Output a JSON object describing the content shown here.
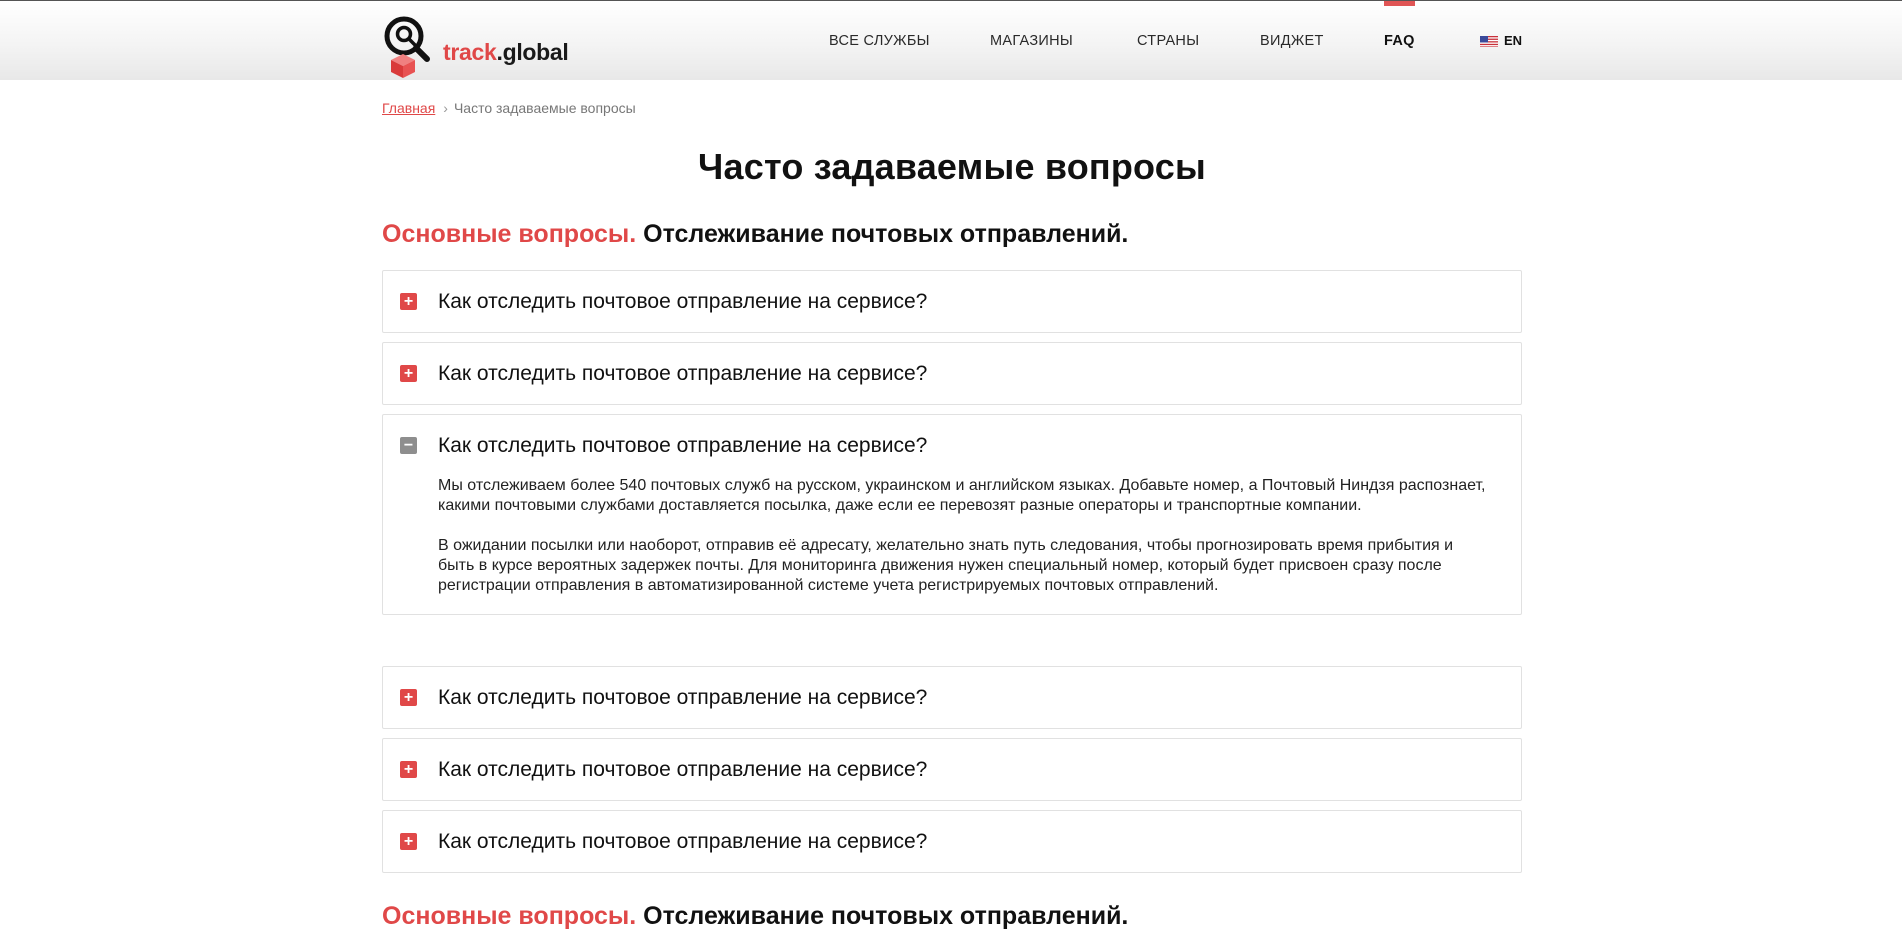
{
  "brand": {
    "name_accent": "track",
    "name_rest": ".global",
    "accent_color": "#e04848"
  },
  "nav": {
    "items": [
      {
        "label": "ВСЕ СЛУЖБЫ"
      },
      {
        "label": "МАГАЗИНЫ"
      },
      {
        "label": "СТРАНЫ"
      },
      {
        "label": "ВИДЖЕТ"
      },
      {
        "label": "FAQ"
      }
    ],
    "active": "FAQ",
    "language": {
      "label": "EN",
      "icon": "us-flag-icon"
    }
  },
  "breadcrumb": {
    "home": "Главная",
    "current": "Часто задаваемые вопросы",
    "separator_icon": "chevron-right-icon"
  },
  "page": {
    "title": "Часто задаваемые вопросы"
  },
  "sections": [
    {
      "accent": "Основные вопросы.",
      "rest": "Отслеживание почтовых отправлений.",
      "items": [
        {
          "question": "Как отследить почтовое отправление на сервисе?",
          "expanded": false,
          "icon": "plus-icon"
        },
        {
          "question": "Как отследить почтовое отправление на сервисе?",
          "expanded": false,
          "icon": "plus-icon"
        },
        {
          "question": "Как отследить почтовое отправление на сервисе?",
          "expanded": true,
          "icon": "minus-icon",
          "answer": [
            "Мы отслеживаем более 540 почтовых служб на русском, украинском и английском языках. Добавьте номер, а Почтовый Ниндзя распознает, какими почтовыми службами доставляется посылка, даже если ее перевозят разные операторы и транспортные компании.",
            "В ожидании посылки или наоборот, отправив её адресату, желательно знать путь следования, чтобы прогнозировать время прибытия и быть в курсе вероятных задержек почты. Для мониторинга движения нужен специальный номер, который будет присвоен сразу после регистрации отправления в автоматизированной системе учета регистрируемых почтовых отправлений."
          ]
        },
        {
          "question": "Как отследить почтовое отправление на сервисе?",
          "expanded": false,
          "icon": "plus-icon"
        },
        {
          "question": "Как отследить почтовое отправление на сервисе?",
          "expanded": false,
          "icon": "plus-icon"
        },
        {
          "question": "Как отследить почтовое отправление на сервисе?",
          "expanded": false,
          "icon": "plus-icon"
        }
      ]
    },
    {
      "accent": "Основные вопросы.",
      "rest": "Отслеживание почтовых отправлений."
    }
  ]
}
